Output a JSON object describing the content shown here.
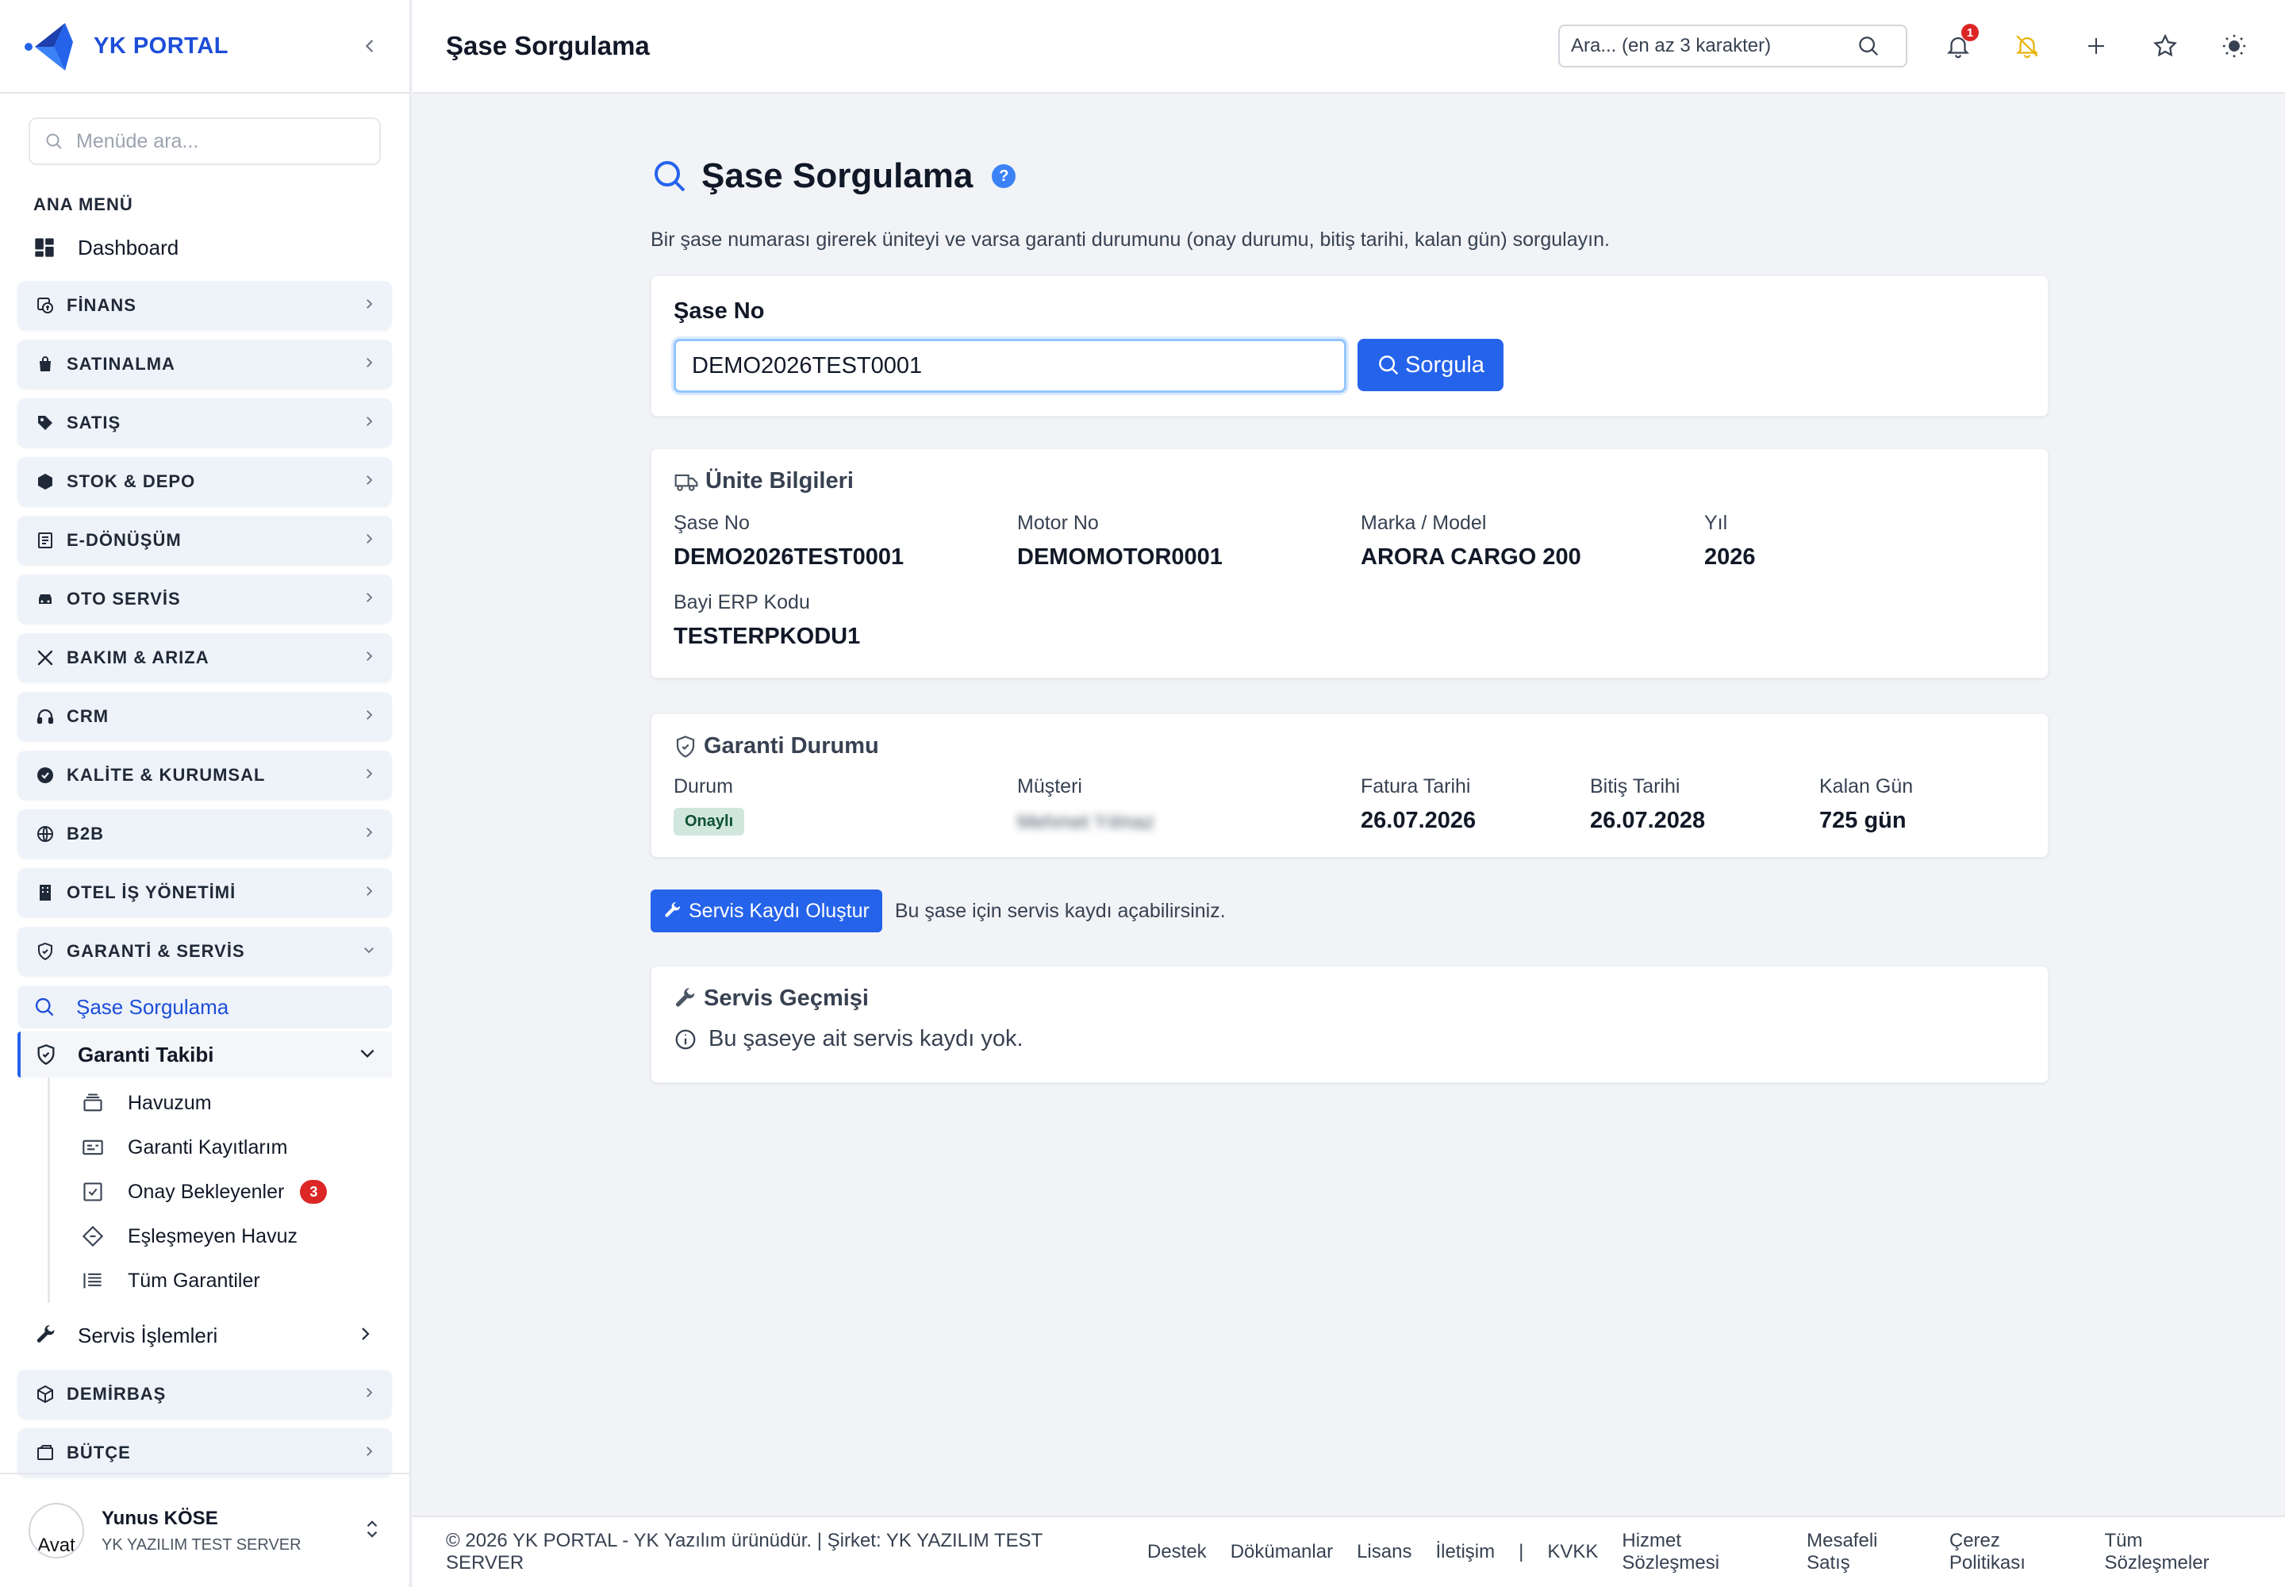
{
  "brand": {
    "name": "YK PORTAL"
  },
  "sidebar": {
    "search_placeholder": "Menüde ara...",
    "section_title": "ANA MENÜ",
    "dashboard": "Dashboard",
    "items": [
      {
        "label": "FİNANS",
        "icon": "finance-icon"
      },
      {
        "label": "SATINALMA",
        "icon": "shopping-bag-icon"
      },
      {
        "label": "SATIŞ",
        "icon": "tag-icon"
      },
      {
        "label": "STOK & DEPO",
        "icon": "box-icon"
      },
      {
        "label": "E-DÖNÜŞÜM",
        "icon": "document-icon"
      },
      {
        "label": "OTO SERVİS",
        "icon": "car-icon"
      },
      {
        "label": "BAKIM & ARIZA",
        "icon": "tools-icon"
      },
      {
        "label": "CRM",
        "icon": "headset-icon"
      },
      {
        "label": "KALİTE & KURUMSAL",
        "icon": "badge-check-icon"
      },
      {
        "label": "B2B",
        "icon": "globe-icon"
      },
      {
        "label": "OTEL İŞ YÖNETİMİ",
        "icon": "building-icon"
      },
      {
        "label": "GARANTİ & SERVİS",
        "icon": "shield-icon"
      }
    ],
    "garanti": {
      "active_item": "Şase Sorgulama",
      "open_item": "Garanti Takibi",
      "sub_items": [
        {
          "label": "Havuzum",
          "icon": "inbox-stack-icon"
        },
        {
          "label": "Garanti Kayıtlarım",
          "icon": "id-card-icon"
        },
        {
          "label": "Onay Bekleyenler",
          "icon": "check-square-icon",
          "badge": "3"
        },
        {
          "label": "Eşleşmeyen Havuz",
          "icon": "diamond-icon"
        },
        {
          "label": "Tüm Garantiler",
          "icon": "list-icon"
        }
      ],
      "service_item": "Servis İşlemleri"
    },
    "items_after": [
      {
        "label": "DEMİRBAŞ",
        "icon": "cube-icon"
      },
      {
        "label": "BÜTÇE",
        "icon": "wallet-icon"
      }
    ],
    "user": {
      "name": "Yunus KÖSE",
      "company": "YK YAZILIM TEST SERVER",
      "avatar_alt": "Avat"
    }
  },
  "topbar": {
    "title": "Şase Sorgulama",
    "search_placeholder": "Ara... (en az 3 karakter)",
    "notification_count": "1"
  },
  "main": {
    "title": "Şase Sorgulama",
    "help": "?",
    "description": "Bir şase numarası girerek üniteyi ve varsa garanti durumunu (onay durumu, bitiş tarihi, kalan gün) sorgulayın.",
    "search": {
      "label": "Şase No",
      "value": "DEMO2026TEST0001",
      "button": "Sorgula"
    },
    "unit": {
      "title": "Ünite Bilgileri",
      "fields": [
        {
          "label": "Şase No",
          "value": "DEMO2026TEST0001"
        },
        {
          "label": "Motor No",
          "value": "DEMOMOTOR0001"
        },
        {
          "label": "Marka / Model",
          "value": "ARORA CARGO 200"
        },
        {
          "label": "Yıl",
          "value": "2026"
        },
        {
          "label": "Bayi ERP Kodu",
          "value": "TESTERPKODU1"
        }
      ]
    },
    "warranty": {
      "title": "Garanti Durumu",
      "status_label": "Durum",
      "status_value": "Onaylı",
      "customer_label": "Müşteri",
      "customer_value": "Mehmet Yılmaz",
      "invoice_label": "Fatura Tarihi",
      "invoice_value": "26.07.2026",
      "end_label": "Bitiş Tarihi",
      "end_value": "26.07.2028",
      "remaining_label": "Kalan Gün",
      "remaining_value": "725 gün"
    },
    "service": {
      "button": "Servis Kaydı Oluştur",
      "note": "Bu şase için servis kaydı açabilirsiniz."
    },
    "history": {
      "title": "Servis Geçmişi",
      "empty": "Bu şaseye ait servis kaydı yok."
    }
  },
  "footer": {
    "copyright": "© 2026 YK PORTAL - YK Yazılım ürünüdür. | Şirket: YK YAZILIM TEST SERVER",
    "links": [
      "Destek",
      "Dökümanlar",
      "Lisans",
      "İletişim"
    ],
    "separator": "|",
    "legal_links": [
      "KVKK",
      "Hizmet Sözleşmesi",
      "Mesafeli Satış",
      "Çerez Politikası",
      "Tüm Sözleşmeler"
    ]
  },
  "colors": {
    "primary": "#2563eb",
    "brand": "#1d4ed8",
    "danger": "#dc2626",
    "success_bg": "#d1e7dd"
  }
}
